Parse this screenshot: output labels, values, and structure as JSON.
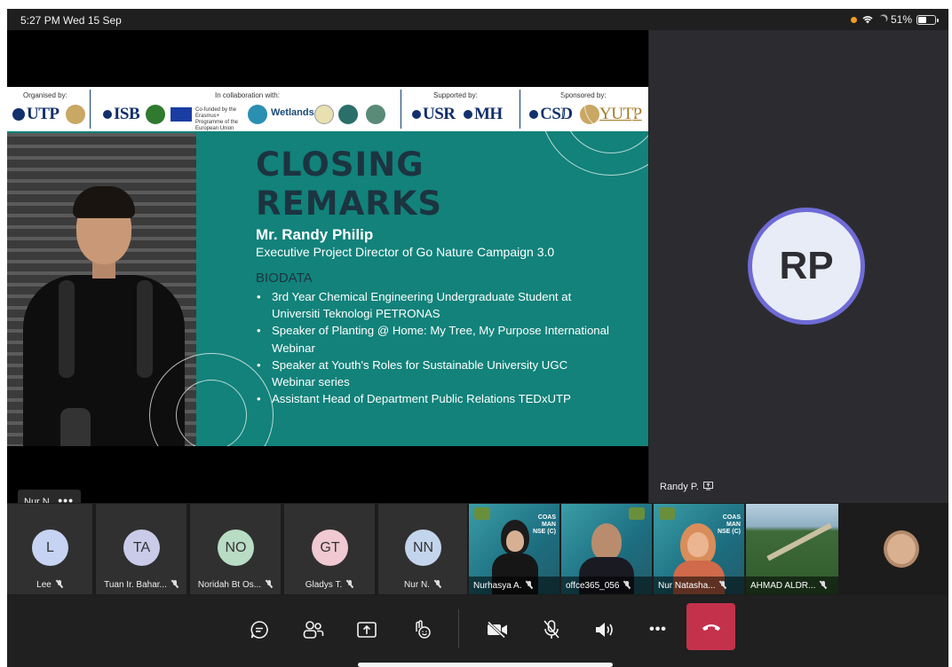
{
  "status_bar": {
    "time": "5:27 PM  Wed 15 Sep",
    "battery": "51%"
  },
  "slide": {
    "strip": {
      "organised_by": "Organised by:",
      "collab": "In collaboration with:",
      "supported_by": "Supported by:",
      "sponsored_by": "Sponsored by:",
      "logo_utp": "UTP",
      "logo_isb": "ISB",
      "eu_text": "Co-funded by the Erasmus+ Programme of the European Union",
      "wetlands": "Wetlands",
      "logo_usr": "USR",
      "logo_mh": "MH",
      "logo_csd": "CSD",
      "logo_yutp": "YUTP"
    },
    "title_line1": "CLOSING",
    "title_line2": "REMARKS",
    "speaker_name": "Mr. Randy Philip",
    "speaker_role": "Executive Project Director of Go Nature Campaign 3.0",
    "bio_heading": "BIODATA",
    "bullets": [
      "3rd Year Chemical Engineering Undergraduate Student at Universiti Teknologi PETRONAS",
      "Speaker of Planting @ Home: My Tree, My Purpose International Webinar",
      "Speaker at Youth's Roles for Sustainable University UGC Webinar series",
      "Assistant Head of Department Public Relations TEDxUTP"
    ]
  },
  "presenter_chip": {
    "name": "Nur N.",
    "more": "•••"
  },
  "side_tile": {
    "initials": "RP",
    "name": "Randy P."
  },
  "gallery": {
    "avatars": [
      {
        "initials": "L",
        "name": "Lee",
        "color": "#c7d3f2"
      },
      {
        "initials": "TA",
        "name": "Tuan Ir. Bahar...",
        "color": "#c9cbe9"
      },
      {
        "initials": "NO",
        "name": "Noridah Bt Os...",
        "color": "#b8dcc4"
      },
      {
        "initials": "GT",
        "name": "Gladys T.",
        "color": "#f0c9d2"
      },
      {
        "initials": "NN",
        "name": "Nur N.",
        "color": "#c3d5ec"
      }
    ],
    "videos": [
      {
        "name": "Nurhasya A."
      },
      {
        "name": "offce365_056"
      },
      {
        "name": "Nur Natasha..."
      },
      {
        "name": "AHMAD ALDR..."
      }
    ],
    "coast_text": "COAS MAN NSE (C)"
  },
  "controls": {
    "chat": "chat-icon",
    "participants": "people-icon",
    "share": "share-tray-icon",
    "react": "reactions-icon",
    "camera": "camera-off-icon",
    "mic": "mic-off-icon",
    "speaker": "speaker-icon",
    "more": "•••",
    "hangup": "hang-up-icon"
  },
  "colors": {
    "slide_bg": "#12827a",
    "accent": "#6f6bd6",
    "hangup": "#c4314b"
  }
}
